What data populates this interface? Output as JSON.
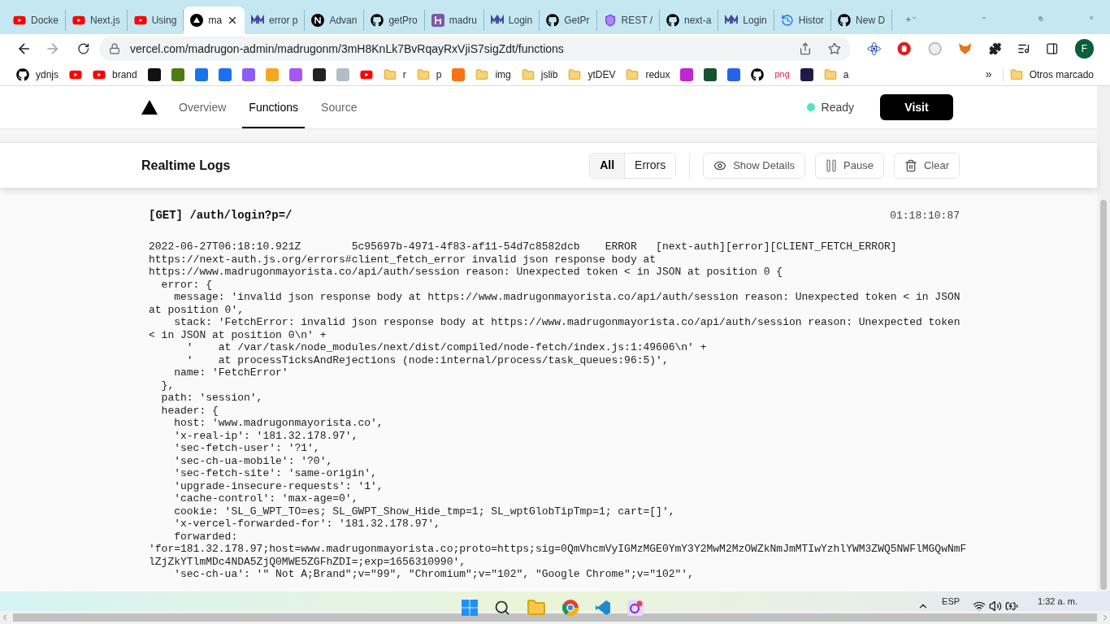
{
  "browser": {
    "tabs": [
      {
        "title": "Docke",
        "kind": "youtube",
        "selected": false
      },
      {
        "title": "Next.js",
        "kind": "youtube",
        "selected": false
      },
      {
        "title": "Using",
        "kind": "youtube",
        "selected": false
      },
      {
        "title": "ma",
        "kind": "triangle",
        "selected": true
      },
      {
        "title": "error p",
        "kind": "mm",
        "selected": false
      },
      {
        "title": "Advan",
        "kind": "n",
        "selected": false
      },
      {
        "title": "getPro",
        "kind": "github",
        "selected": false
      },
      {
        "title": "madru",
        "kind": "h",
        "selected": false
      },
      {
        "title": "Login",
        "kind": "mm",
        "selected": false
      },
      {
        "title": "GetPr",
        "kind": "github",
        "selected": false
      },
      {
        "title": "REST /",
        "kind": "shield",
        "selected": false
      },
      {
        "title": "next-a",
        "kind": "github",
        "selected": false
      },
      {
        "title": "Login",
        "kind": "mm",
        "selected": false
      },
      {
        "title": "Histor",
        "kind": "clock",
        "selected": false
      },
      {
        "title": "New D",
        "kind": "github",
        "selected": false
      }
    ],
    "address": "vercel.com/madrugon-admin/madrugonm/3mH8KnLk7BvRqayRxVjiS7sigZdt/functions",
    "profile_initial": "F",
    "bookmarks": [
      {
        "label": "ydnjs",
        "kind": "github"
      },
      {
        "kind": "youtube"
      },
      {
        "label": "brand",
        "kind": "youtube"
      },
      {
        "kind": "square",
        "color": "#111111"
      },
      {
        "kind": "square",
        "color": "#4d7c0f"
      },
      {
        "kind": "square",
        "color": "#1a73e8"
      },
      {
        "kind": "square",
        "color": "#1d6ff2"
      },
      {
        "kind": "square",
        "color": "#8b5cf6"
      },
      {
        "kind": "square",
        "color": "#f5a623"
      },
      {
        "kind": "square",
        "color": "#a855f7"
      },
      {
        "kind": "square",
        "color": "#222222"
      },
      {
        "kind": "square",
        "color": "#b0bec5"
      },
      {
        "kind": "youtube"
      },
      {
        "label": "r",
        "kind": "folder"
      },
      {
        "label": "p",
        "kind": "folder"
      },
      {
        "kind": "square",
        "color": "#f97316"
      },
      {
        "label": "img",
        "kind": "folder"
      },
      {
        "label": "jslib",
        "kind": "folder"
      },
      {
        "label": "ytDEV",
        "kind": "folder"
      },
      {
        "label": "redux",
        "kind": "folder"
      },
      {
        "kind": "square",
        "color": "#c026d3"
      },
      {
        "kind": "square",
        "color": "#14532d"
      },
      {
        "kind": "square",
        "color": "#2563eb"
      },
      {
        "kind": "github"
      },
      {
        "label": "png",
        "kind": "red-text"
      },
      {
        "kind": "square",
        "color": "#1e1b4b"
      },
      {
        "label": "a",
        "kind": "folder"
      }
    ],
    "more": "»",
    "other_bookmarks": "Otros marcado"
  },
  "nav": {
    "items": [
      {
        "label": "Overview",
        "selected": false
      },
      {
        "label": "Functions",
        "selected": true
      },
      {
        "label": "Source",
        "selected": false
      }
    ],
    "status": "Ready",
    "visit": "Visit"
  },
  "logs": {
    "title": "Realtime Logs",
    "filters": [
      {
        "label": "All",
        "selected": true
      },
      {
        "label": "Errors",
        "selected": false
      }
    ],
    "actions": [
      {
        "label": "Show Details",
        "kind": "eye"
      },
      {
        "label": "Pause",
        "kind": "pause"
      },
      {
        "label": "Clear",
        "kind": "trash"
      }
    ],
    "entry": {
      "request": "[GET] /auth/login?p=/",
      "time": "01:18:10:87",
      "lines": [
        "2022-06-27T06:18:10.921Z        5c95697b-4971-4f83-af11-54d7c8582dcb    ERROR   [next-auth][error][CLIENT_FETCH_ERROR]",
        "https://next-auth.js.org/errors#client_fetch_error invalid json response body at",
        "https://www.madrugonmayorista.co/api/auth/session reason: Unexpected token < in JSON at position 0 {",
        "  error: {",
        "    message: 'invalid json response body at https://www.madrugonmayorista.co/api/auth/session reason: Unexpected token < in JSON",
        "at position 0',",
        "    stack: 'FetchError: invalid json response body at https://www.madrugonmayorista.co/api/auth/session reason: Unexpected token",
        "< in JSON at position 0\\n' +",
        "      '    at /var/task/node_modules/next/dist/compiled/node-fetch/index.js:1:49606\\n' +",
        "      '    at processTicksAndRejections (node:internal/process/task_queues:96:5)',",
        "    name: 'FetchError'",
        "  },",
        "  path: 'session',",
        "  header: {",
        "    host: 'www.madrugonmayorista.co',",
        "    'x-real-ip': '181.32.178.97',",
        "    'sec-fetch-user': '?1',",
        "    'sec-ch-ua-mobile': '?0',",
        "    'sec-fetch-site': 'same-origin',",
        "    'upgrade-insecure-requests': '1',",
        "    'cache-control': 'max-age=0',",
        "    cookie: 'SL_G_WPT_TO=es; SL_GWPT_Show_Hide_tmp=1; SL_wptGlobTipTmp=1; cart=[]',",
        "    'x-vercel-forwarded-for': '181.32.178.97',",
        "    forwarded:",
        "'for=181.32.178.97;host=www.madrugonmayorista.co;proto=https;sig=0QmVhcmVyIGMzMGE0YmY3Y2MwM2MzOWZkNmJmMTIwYzhlYWM3ZWQ5NWFlMGQwNmF",
        "lZjZkYTlmMDc4NDA5ZjQ0MWE5ZGFhZDI=;exp=1656310990',",
        "    'sec-ch-ua': '\" Not A;Brand\";v=\"99\", \"Chromium\";v=\"102\", \"Google Chrome\";v=\"102\"',"
      ]
    }
  },
  "taskbar": {
    "language": "ESP",
    "clock": "1:32 a. m."
  }
}
